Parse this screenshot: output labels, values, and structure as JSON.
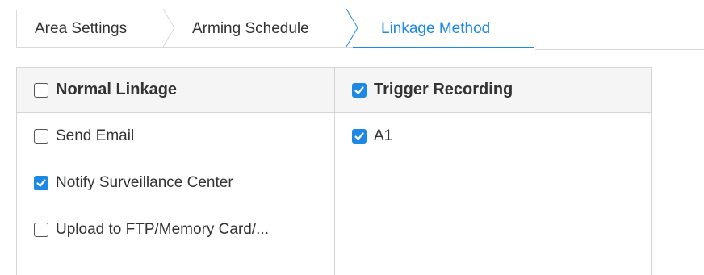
{
  "tabs": [
    {
      "label": "Area Settings",
      "active": false
    },
    {
      "label": "Arming Schedule",
      "active": false
    },
    {
      "label": "Linkage Method",
      "active": true
    }
  ],
  "colors": {
    "accent": "#1e88e5",
    "border": "#d4d4d4",
    "header_bg": "#f5f5f5",
    "text": "#333333"
  },
  "normal_linkage": {
    "header": {
      "label": "Normal Linkage",
      "checked": false
    },
    "items": [
      {
        "label": "Send Email",
        "checked": false
      },
      {
        "label": "Notify Surveillance Center",
        "checked": true
      },
      {
        "label": "Upload to FTP/Memory Card/...",
        "checked": false
      }
    ]
  },
  "trigger_recording": {
    "header": {
      "label": "Trigger Recording",
      "checked": true
    },
    "items": [
      {
        "label": "A1",
        "checked": true
      }
    ]
  }
}
